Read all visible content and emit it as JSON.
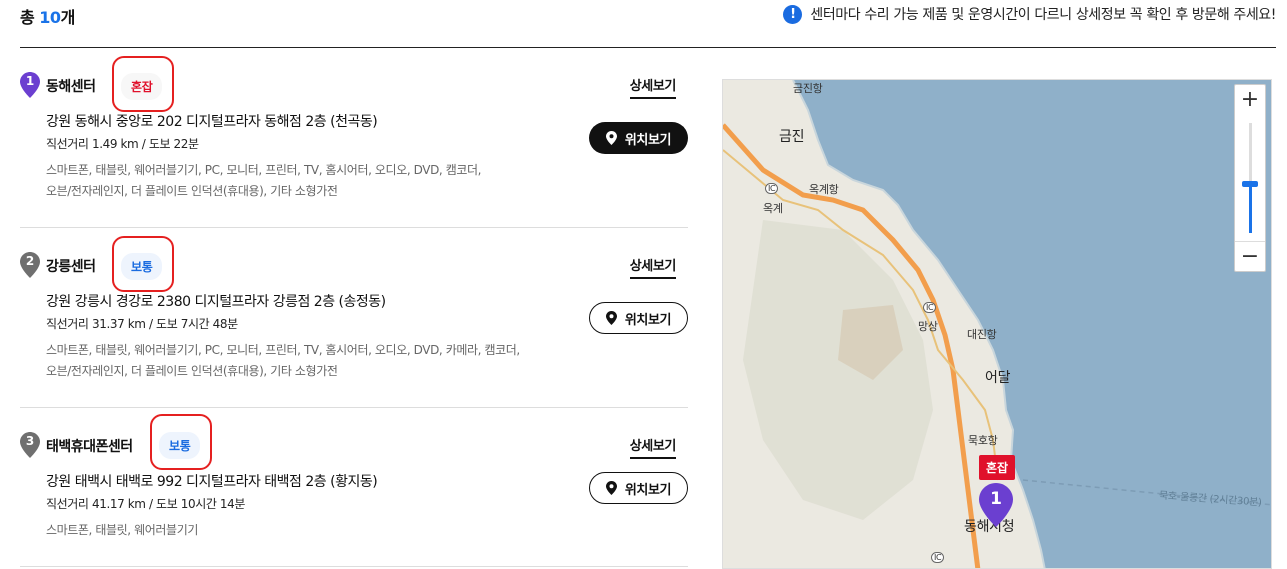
{
  "header": {
    "total_prefix": "총 ",
    "total_count": "10",
    "total_suffix": "개",
    "notice_icon": "info-icon",
    "notice_text": "센터마다 수리 가능 제품 및 운영시간이 다르니 상세정보 꼭 확인 후 방문해 주세요!"
  },
  "centers": [
    {
      "number": "1",
      "name": "동해센터",
      "status": "혼잡",
      "detail_label": "상세보기",
      "location_label": "위치보기",
      "address": "강원 동해시 중앙로 202 디지털프라자 동해점 2층 (천곡동)",
      "distance": "직선거리 1.49 km / 도보 22분",
      "products_line1": "스마트폰, 태블릿, 웨어러블기기, PC, 모니터, 프린터, TV, 홈시어터, 오디오, DVD, 캠코더,",
      "products_line2": "오븐/전자레인지, 더 플레이트 인덕션(휴대용), 기타 소형가전"
    },
    {
      "number": "2",
      "name": "강릉센터",
      "status": "보통",
      "detail_label": "상세보기",
      "location_label": "위치보기",
      "address": "강원 강릉시 경강로 2380 디지털프라자 강릉점 2층 (송정동)",
      "distance": "직선거리 31.37 km / 도보 7시간 48분",
      "products_line1": "스마트폰, 태블릿, 웨어러블기기, PC, 모니터, 프린터, TV, 홈시어터, 오디오, DVD, 카메라, 캠코더,",
      "products_line2": "오븐/전자레인지, 더 플레이트 인덕션(휴대용), 기타 소형가전"
    },
    {
      "number": "3",
      "name": "태백휴대폰센터",
      "status": "보통",
      "detail_label": "상세보기",
      "location_label": "위치보기",
      "address": "강원 태백시 태백로 992 디지털프라자 태백점 2층 (황지동)",
      "distance": "직선거리 41.17 km / 도보 10시간 14분",
      "products_line1": "스마트폰, 태블릿, 웨어러블기기"
    }
  ],
  "map": {
    "zoom_in": "+",
    "zoom_out": "−",
    "zoom_level_fraction": 0.45,
    "marker_status": "혼잡",
    "marker_number": "1",
    "labels": {
      "geumjin_port": "금진항",
      "geumjin": "금진",
      "okgye_port": "옥계항",
      "ic": "IC",
      "okgye": "옥계",
      "mangsang": "망상",
      "daejin_port": "대진항",
      "eodal": "어달",
      "mukho_port": "묵호항",
      "ferry_route": "묵호-울릉간 (2시간30분)",
      "donghae_cityhall": "동해시청"
    }
  },
  "colors": {
    "pin_active": "#6b3fd0",
    "pin_inactive": "#6f6f6f",
    "busy": "#e0112b",
    "normal": "#1a6be0",
    "highlight_circle": "#e52020",
    "sea": "#8fb0c9",
    "land": "#ebe9e1"
  }
}
